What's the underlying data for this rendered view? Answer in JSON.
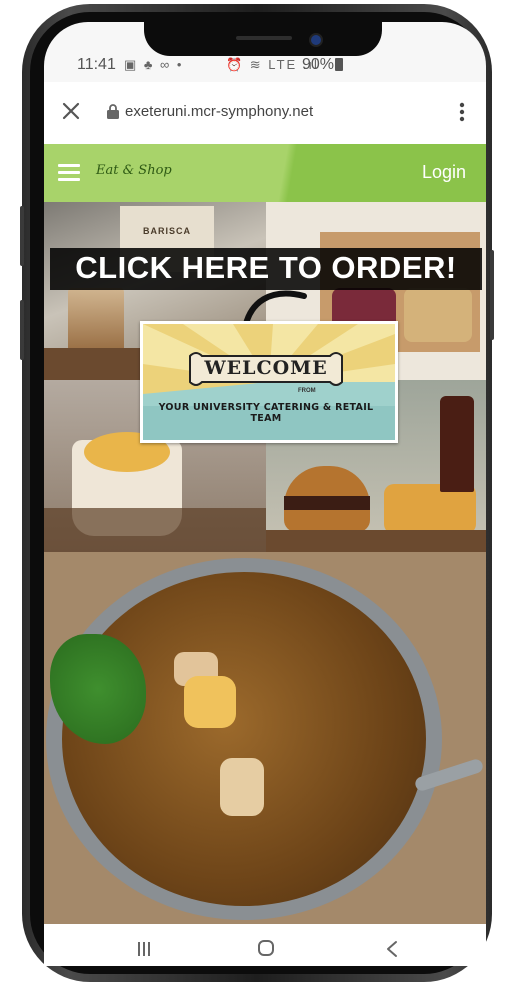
{
  "status_bar": {
    "time": "11:41",
    "left_icons": "▣ ♣ ∞ •",
    "right_icons": "⏰ ≋ LTE .ıl",
    "battery": "90%"
  },
  "browser": {
    "url": "exeteruni.mcr-symphony.net"
  },
  "site_header": {
    "brand": "Eat & Shop",
    "login_label": "Login"
  },
  "promo": {
    "banner_text": "CLICK HERE TO ORDER!",
    "welcome_word": "WELCOME",
    "from_text": "FROM",
    "team_text": "YOUR UNIVERSITY CATERING & RETAIL TEAM",
    "coffee_bag_label": "BARISCA"
  },
  "colors": {
    "header_green_light": "#a8d36a",
    "header_green": "#8bc34a",
    "banner_bg": "#000000"
  },
  "icons": [
    "close-icon",
    "lock-icon",
    "more-vert-icon",
    "hamburger-menu-icon",
    "nav-recent-apps-icon",
    "nav-home-icon",
    "nav-back-icon"
  ]
}
